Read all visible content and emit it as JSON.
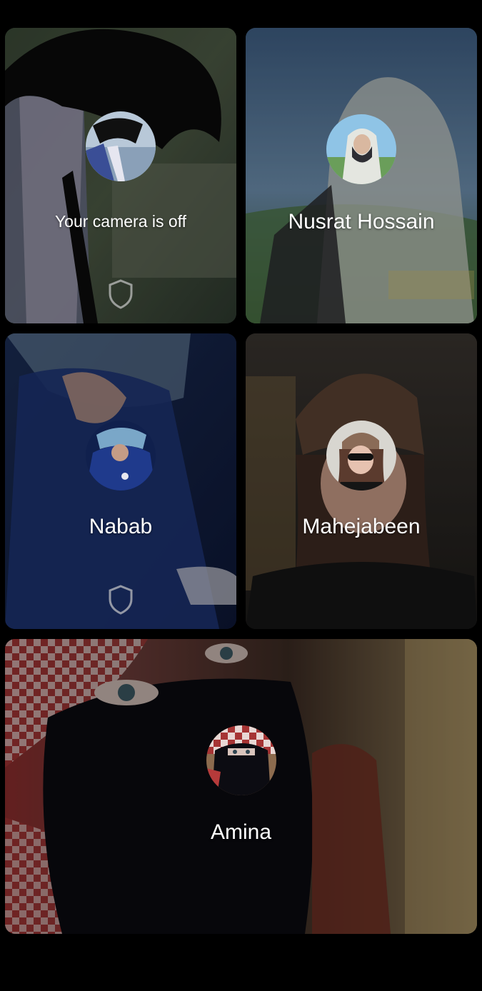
{
  "participants": [
    {
      "name": "Your camera is off",
      "avatar": "avatar-self",
      "background": "self-photo",
      "show_shield": true
    },
    {
      "name": "Nusrat Hossain",
      "avatar": "avatar-nusrat",
      "background": "nusrat-photo",
      "show_shield": false
    },
    {
      "name": "Nabab",
      "avatar": "avatar-nabab",
      "background": "nabab-photo",
      "show_shield": true
    },
    {
      "name": "Mahejabeen",
      "avatar": "avatar-mahejabeen",
      "background": "mahejabeen-photo",
      "show_shield": false
    },
    {
      "name": "Amina",
      "avatar": "avatar-amina",
      "background": "amina-photo",
      "show_shield": false
    }
  ],
  "icons": {
    "shield": "shield-icon"
  },
  "colors": {
    "background": "#000000",
    "label": "#ffffff"
  }
}
